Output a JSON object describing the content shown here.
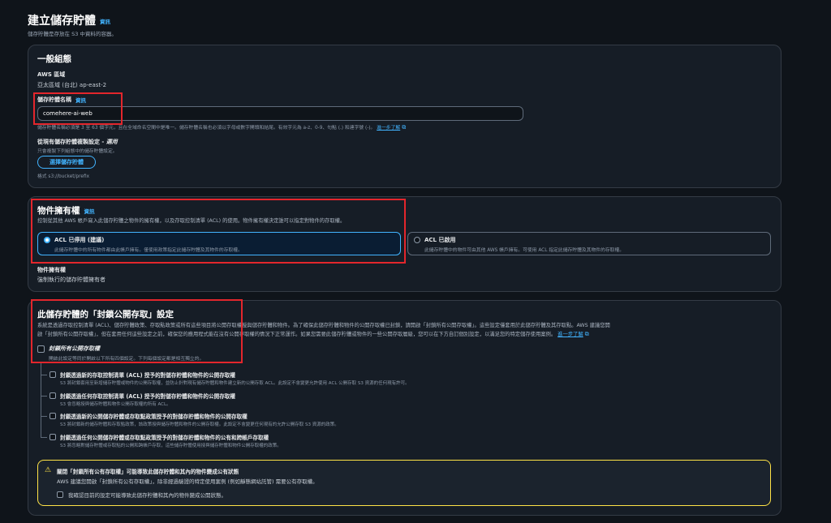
{
  "header": {
    "title": "建立儲存貯體",
    "info": "資訊",
    "subtitle": "儲存貯體是存放在 S3 中資料的容器。"
  },
  "general": {
    "title": "一般組態",
    "region_label": "AWS 區域",
    "region_value": "亞太區域 (台北) ap-east-2",
    "bucket_name_label": "儲存貯體名稱",
    "bucket_name_info": "資訊",
    "bucket_name_value": "comehere-ai-web",
    "bucket_name_hint": "儲存貯體名稱必須是 3 至 63 個字元，且在全域命名空間中是唯一。儲存貯體名稱也必須以字母或數字開頭和結尾。有效字元為 a-z、0-9、句點 (.) 和連字號 (-)。",
    "learn_more": "進一步了解",
    "copy_label": "從現有儲存貯體複製設定 - ",
    "copy_optional": "選用",
    "copy_desc": "只會複製下列組態中的儲存貯體設定。",
    "choose_bucket_button": "選擇儲存貯體",
    "format_hint": "格式 s3://bucket/prefix"
  },
  "ownership": {
    "title": "物件擁有權",
    "info": "資訊",
    "desc": "控制從其他 AWS 帳戶寫入此儲存貯體之物件的擁有權，以及存取控制清單 (ACL) 的使用。物件擁有權決定誰可以指定對物件的存取權。",
    "option_disabled_title": "ACL 已停用 (建議)",
    "option_disabled_desc": "此儲存貯體中的所有物件都由此帳戶擁有。僅使用政策指定此儲存貯體及其物件的存取權。",
    "option_enabled_title": "ACL 已啟用",
    "option_enabled_desc": "此儲存貯體中的物件可由其他 AWS 帳戶擁有。可使用 ACL 指定此儲存貯體及其物件的存取權。",
    "result_label": "物件擁有權",
    "result_value": "強制執行的儲存貯體擁有者"
  },
  "block_public": {
    "title": "此儲存貯體的「封鎖公開存取」設定",
    "desc1": "系統是透過存取控制清單 (ACL)、儲存貯體政策、存取點政策或所有這些項目將公開存取權授與儲存貯體和物件。為了確保此儲存貯體和物件的公開存取權已封鎖，請開啟「封鎖所有公開存取權」。這些設定僅套用於此儲存貯體及其存取點。AWS 建議您開",
    "desc2": "啟「封鎖所有公開存取權」，但在套用任何這些設定之前，確保您的應用程式能在沒有公開存取權的情況下正常運作。如果您需要此儲存貯體或物件的一些公開存取層級，您可以在下方自訂個別設定，以滿足您的特定儲存使用案例。",
    "learn_more": "進一步了解",
    "block_all_label": "封鎖所有公開存取權",
    "block_all_desc": "開啟此設定等同於開啟以下所有四個設定。下列每個設定都是相互獨立的。",
    "options": [
      {
        "title": "封鎖透過新的存取控制清單 (ACL) 授予的對儲存貯體和物件的公開存取權",
        "desc": "S3 將封鎖套用至新增儲存貯體或物件的公開存取權，並防止針對現有儲存貯體和物件建立新的公開存取 ACL。此設定不會變更允許使用 ACL 公開存取 S3 資源的任何現有許可。"
      },
      {
        "title": "封鎖透過任何存取控制清單 (ACL) 授予的對儲存貯體和物件的公開存取權",
        "desc": "S3 會忽略授與儲存貯體和物件公開存取權的所有 ACL。"
      },
      {
        "title": "封鎖透過新的公開儲存貯體或存取點政策授予的對儲存貯體和物件的公開存取權",
        "desc": "S3 將封鎖新的儲存貯體和存取點政策，該政策授與儲存貯體和物件的公開存取權。此設定不會變更任何現有的允許公開存取 S3 資源的政策。"
      },
      {
        "title": "封鎖透過任何公開儲存貯體或存取點政策授予的對儲存貯體和物件的公有和跨帳戶存取權",
        "desc": "S3 將忽略對儲存貯體或存取點的公開和跨帳戶存取，這些儲存貯體使用授與儲存貯體和物件公開存取權的政策。"
      }
    ],
    "warning_title": "關閉「封鎖所有公有存取權」可能導致此儲存貯體和其內的物件變成公有狀態",
    "warning_desc": "AWS 建議您開啟「封鎖所有公有存取權」，除非經過驗證的特定使用案例 (例如靜態網站託管) 需要公有存取權。",
    "acknowledge": "我確認目前的設定可能導致此儲存貯體和其內的物件變成公開狀態。"
  }
}
